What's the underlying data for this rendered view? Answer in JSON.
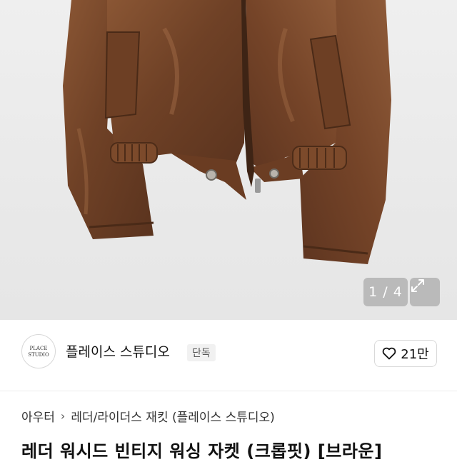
{
  "gallery": {
    "counter": "1 / 4",
    "image_alt": "브라운 레더 자켓",
    "expand_icon": "expand-icon"
  },
  "shop": {
    "name": "플레이스 스튜디오",
    "badge": "단독",
    "logo_text": "PLACE STUDIO",
    "like_count": "21만",
    "like_icon": "heart-outline-icon"
  },
  "breadcrumb": {
    "category": "아우터",
    "subcategory": "레더/라이더스 재킷 (플레이스 스튜디오)"
  },
  "product": {
    "title": "레더 워시드 빈티지 워싱 자켓 (크롭핏) [브라운]"
  },
  "colors": {
    "jacket": "#7a4a2c",
    "background": "#ececec",
    "badge_bg": "#f1f1f1"
  }
}
